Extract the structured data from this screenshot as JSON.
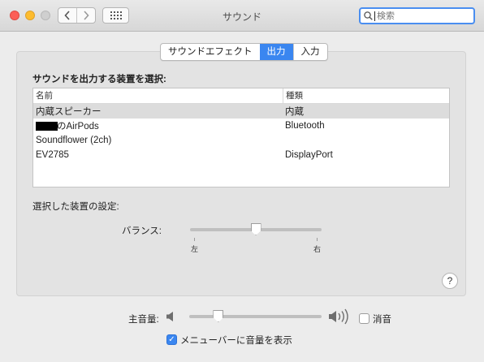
{
  "window": {
    "title": "サウンド"
  },
  "search": {
    "placeholder": "検索"
  },
  "tabs": [
    {
      "label": "サウンドエフェクト",
      "active": false
    },
    {
      "label": "出力",
      "active": true
    },
    {
      "label": "入力",
      "active": false
    }
  ],
  "output": {
    "section_title": "サウンドを出力する装置を選択:",
    "columns": [
      "名前",
      "種類"
    ],
    "devices": [
      {
        "name": "内蔵スピーカー",
        "type": "内蔵",
        "selected": true
      },
      {
        "name": "のAirPods",
        "type": "Bluetooth",
        "selected": false,
        "name_redacted_prefix": true
      },
      {
        "name": "Soundflower (2ch)",
        "type": "",
        "selected": false
      },
      {
        "name": "EV2785",
        "type": "DisplayPort",
        "selected": false
      }
    ],
    "settings_title": "選択した装置の設定:",
    "balance": {
      "label": "バランス:",
      "left_label": "左",
      "right_label": "右",
      "value": 0.5
    }
  },
  "help": {
    "label": "?"
  },
  "volume": {
    "label": "主音量:",
    "value": 0.22,
    "mute_label": "消音",
    "mute_checked": false
  },
  "menubar_option": {
    "label": "メニューバーに音量を表示",
    "checked": true
  }
}
